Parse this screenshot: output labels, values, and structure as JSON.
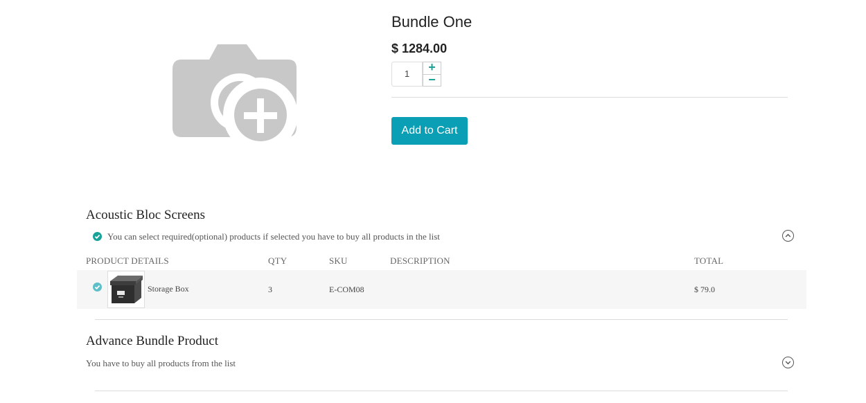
{
  "product": {
    "title": "Bundle One",
    "price": "$ 1284.00",
    "quantity": "1",
    "plus_label": "+",
    "minus_label": "−",
    "add_to_cart_label": "Add to Cart"
  },
  "sections": [
    {
      "title": "Acoustic Bloc Screens",
      "note": "You can select required(optional) products if selected you have to buy all products in the list",
      "expanded": true,
      "table": {
        "headers": [
          "PRODUCT DETAILS",
          "QTY",
          "SKU",
          "DESCRIPTION",
          "TOTAL"
        ],
        "rows": [
          {
            "name": "Storage Box",
            "qty": "3",
            "sku": "E-COM08",
            "description": "",
            "total": "$ 79.0"
          }
        ]
      }
    },
    {
      "title": "Advance Bundle Product",
      "note": "You have to buy all products from the list",
      "expanded": false
    }
  ],
  "icons": {
    "placeholder": "camera-plus-icon",
    "check": "check-circle-icon",
    "expand": "chevron-up-icon",
    "collapse": "chevron-down-icon",
    "thumb": "storage-box-image"
  },
  "colors": {
    "accent": "#0a9fb4",
    "check": "#17a398",
    "placeholder": "#c8c8c8"
  }
}
